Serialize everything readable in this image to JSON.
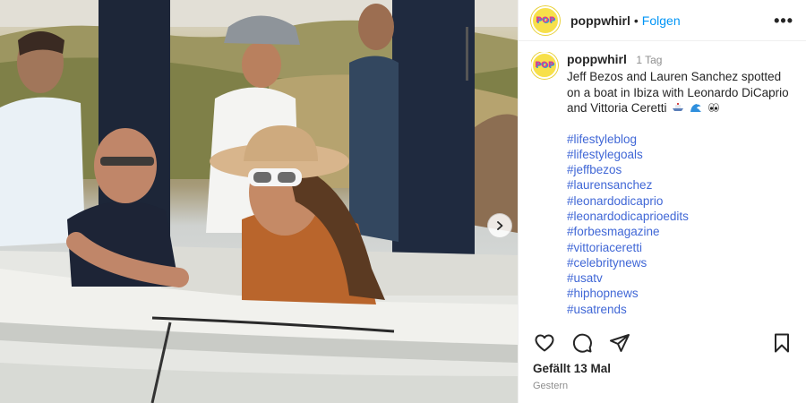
{
  "post": {
    "username": "poppwhirl",
    "follow_label": "Folgen",
    "dot": "•",
    "more_label": "•••",
    "avatar_text": "POP"
  },
  "caption": {
    "username": "poppwhirl",
    "time": "1 Tag",
    "text": "Jeff Bezos and Lauren Sanchez spotted on a boat in Ibiza with Leonardo DiCaprio and Vittoria Ceretti",
    "emojis": [
      "boat-emoji",
      "wave-emoji",
      "eyes-emoji"
    ],
    "hashtags": [
      "#lifestyleblog",
      "#lifestylegoals",
      "#jeffbezos",
      "#laurensanchez",
      "#leonardodicaprio",
      "#leonardodicaprioedits",
      "#forbesmagazine",
      "#vittoriaceretti",
      "#celebritynews",
      "#usatv",
      "#hiphopnews",
      "#usatrends"
    ]
  },
  "actions": {
    "icons": [
      "heart-icon",
      "comment-icon",
      "share-icon",
      "bookmark-icon"
    ]
  },
  "likes": "Gefällt 13 Mal",
  "date": "Gestern",
  "colors": {
    "link_blue": "#0095f6",
    "hashtag_blue": "#4067d6",
    "avatar_yellow": "#f7e04a",
    "avatar_pink": "#e13a8c",
    "muted_gray": "#8e8e8e"
  }
}
